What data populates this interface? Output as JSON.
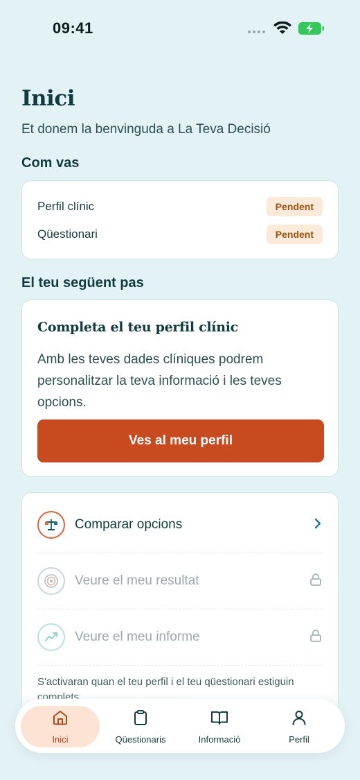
{
  "status_bar": {
    "time": "09:41"
  },
  "header": {
    "title": "Inici",
    "subtitle": "Et donem la benvinguda a La Teva Decisió"
  },
  "progress_section": {
    "title": "Com vas",
    "items": [
      {
        "label": "Perfil clínic",
        "badge": "Pendent"
      },
      {
        "label": "Qüestionari",
        "badge": "Pendent"
      }
    ]
  },
  "next_step": {
    "section_title": "El teu següent pas",
    "card_title": "Completa el teu perfil clínic",
    "description": "Amb les teves dades clíniques podrem personalitzar la teva informació i les teves opcions.",
    "button_label": "Ves al meu perfil"
  },
  "actions": {
    "items": [
      {
        "label": "Comparar opcions",
        "icon": "balance-scale-icon",
        "state": "active"
      },
      {
        "label": "Veure el meu resultat",
        "icon": "target-icon",
        "state": "locked"
      },
      {
        "label": "Veure el meu informe",
        "icon": "trend-chart-icon",
        "state": "locked"
      }
    ],
    "note": "S'activaran quan el teu perfil i el teu qüestionari estiguin complets"
  },
  "tab_bar": {
    "tabs": [
      {
        "label": "Inici",
        "icon": "home-icon",
        "active": true
      },
      {
        "label": "Qüestionaris",
        "icon": "clipboard-icon",
        "active": false
      },
      {
        "label": "Informació",
        "icon": "book-icon",
        "active": false
      },
      {
        "label": "Perfil",
        "icon": "user-icon",
        "active": false
      }
    ]
  },
  "colors": {
    "background": "#e3f2f4",
    "primary": "#c74b1e",
    "badge_bg": "#fbe9d9",
    "badge_text": "#9b5410",
    "heading": "#123b40",
    "accent_teal": "#1d7a8c",
    "battery": "#34c759"
  }
}
